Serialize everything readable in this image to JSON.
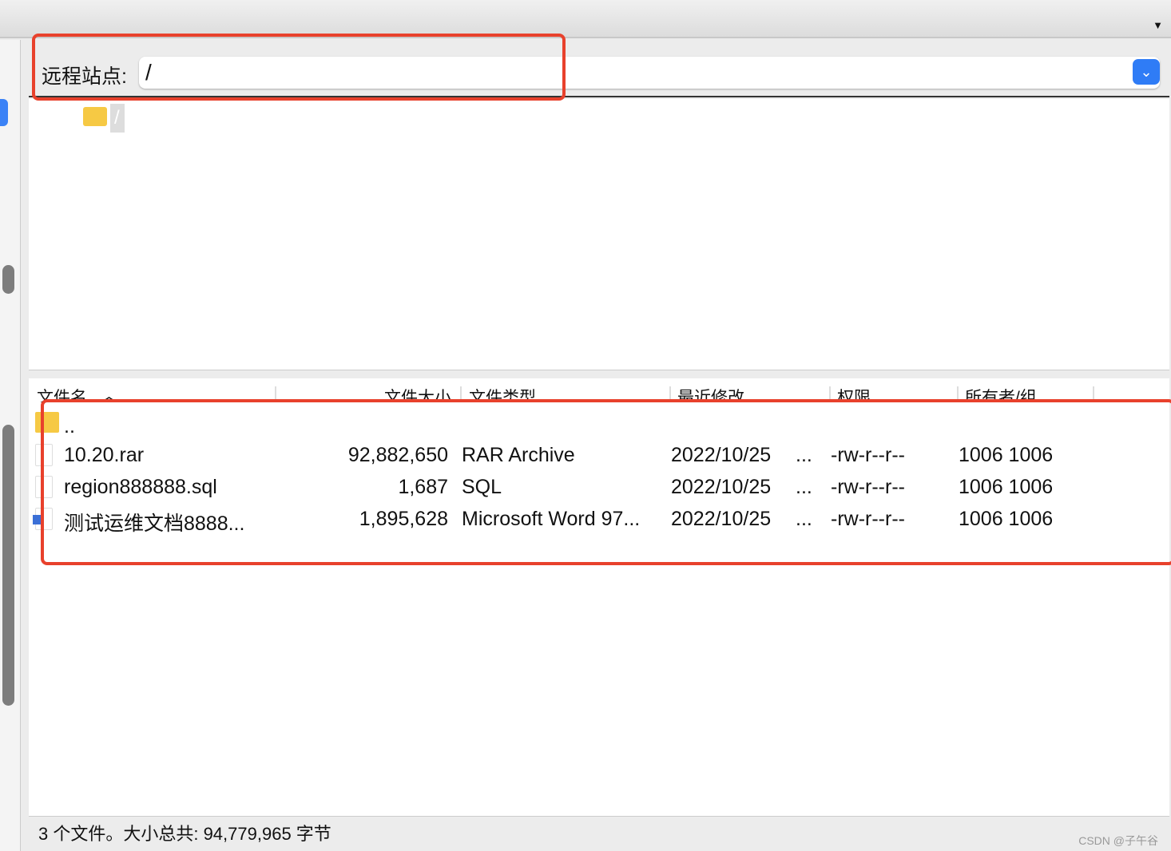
{
  "site": {
    "label": "远程站点:",
    "path": "/"
  },
  "tree": {
    "root": "/"
  },
  "columns": [
    "文件名",
    "文件大小",
    "文件类型",
    "最近修改",
    "权限",
    "所有者/组"
  ],
  "files": [
    {
      "name": "..",
      "size": "",
      "type": "",
      "modified": "",
      "perm": "",
      "owner": ""
    },
    {
      "name": "10.20.rar",
      "size": "92,882,650",
      "type": "RAR Archive",
      "modified": "2022/10/25",
      "more": "...",
      "perm": "-rw-r--r--",
      "owner": "1006 1006"
    },
    {
      "name": "region888888.sql",
      "size": "1,687",
      "type": "SQL",
      "modified": "2022/10/25",
      "more": "...",
      "perm": "-rw-r--r--",
      "owner": "1006 1006"
    },
    {
      "name": "测试运维文档8888...",
      "size": "1,895,628",
      "type": "Microsoft Word 97...",
      "modified": "2022/10/25",
      "more": "...",
      "perm": "-rw-r--r--",
      "owner": "1006 1006"
    }
  ],
  "status": "3 个文件。大小总共: 94,779,965 字节",
  "watermark": "CSDN @子午谷",
  "colors": {
    "accent": "#2f7cf6",
    "highlight": "#e8412c",
    "folder": "#f6c944"
  }
}
